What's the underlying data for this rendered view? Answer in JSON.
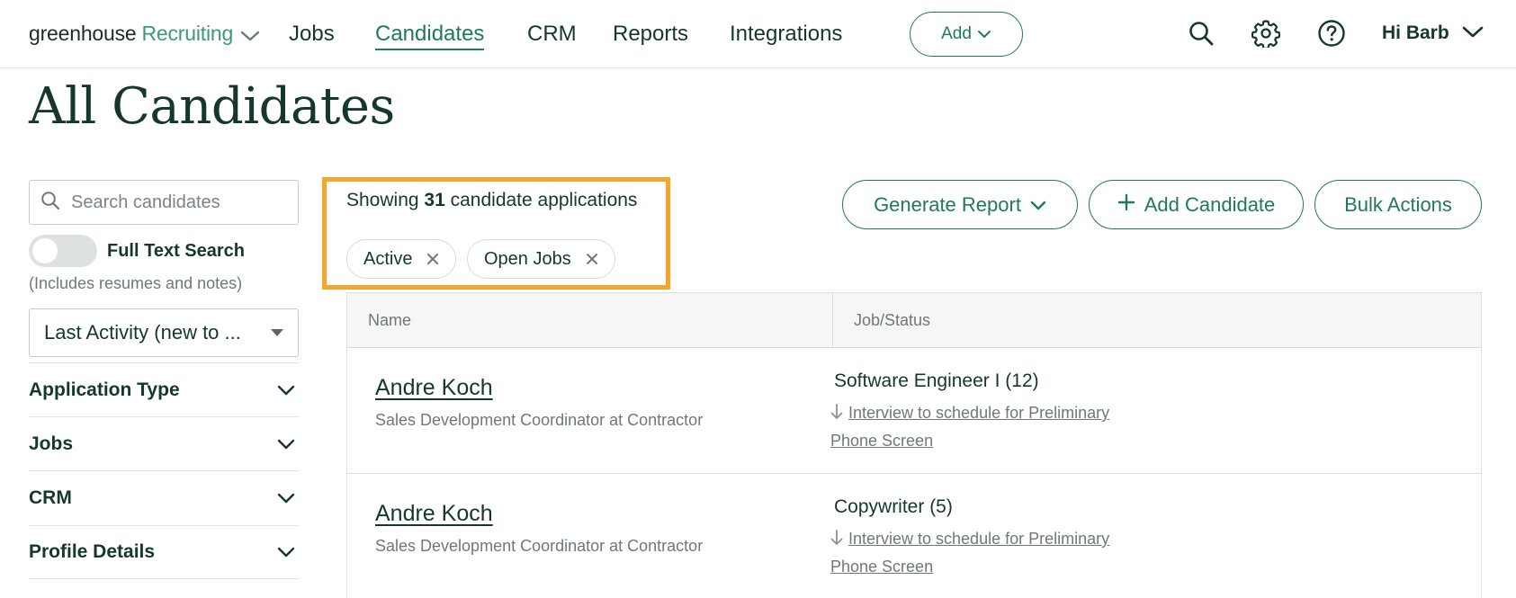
{
  "nav": {
    "logo_main": "greenhouse",
    "logo_product": "Recruiting",
    "links": [
      {
        "label": "Jobs"
      },
      {
        "label": "Candidates"
      },
      {
        "label": "CRM"
      },
      {
        "label": "Reports"
      },
      {
        "label": "Integrations"
      }
    ],
    "active_link": "Candidates",
    "add_label": "Add",
    "user_greeting": "Hi Barb",
    "icons": [
      "search-icon",
      "gear-icon",
      "help-icon"
    ]
  },
  "page": {
    "title": "All Candidates"
  },
  "sidebar": {
    "search_placeholder": "Search candidates",
    "full_text_label": "Full Text Search",
    "full_text_enabled": false,
    "full_text_hint": "(Includes resumes and notes)",
    "sort_value": "Last Activity (new to ...",
    "filters": [
      {
        "label": "Application Type"
      },
      {
        "label": "Jobs"
      },
      {
        "label": "CRM"
      },
      {
        "label": "Profile Details"
      }
    ]
  },
  "results": {
    "showing_prefix": "Showing",
    "count": "31",
    "showing_suffix": "candidate applications",
    "chips": [
      {
        "label": "Active"
      },
      {
        "label": "Open Jobs"
      }
    ]
  },
  "actions": {
    "generate_report": "Generate Report",
    "add_candidate": "Add Candidate",
    "bulk_actions": "Bulk Actions"
  },
  "table": {
    "columns": [
      "Name",
      "Job/Status"
    ],
    "rows": [
      {
        "name": "Andre Koch",
        "title": "Sales Development Coordinator at Contractor",
        "job": "Software Engineer I (12)",
        "status_line1": "Interview to schedule for Preliminary",
        "status_line2": "Phone Screen"
      },
      {
        "name": "Andre Koch",
        "title": "Sales Development Coordinator at Contractor",
        "job": "Copywriter (5)",
        "status_line1": "Interview to schedule for Preliminary",
        "status_line2": "Phone Screen"
      }
    ]
  },
  "colors": {
    "brand_green": "#1e7a5c",
    "dark_text": "#15372c",
    "highlight_orange": "#f5a52c"
  }
}
